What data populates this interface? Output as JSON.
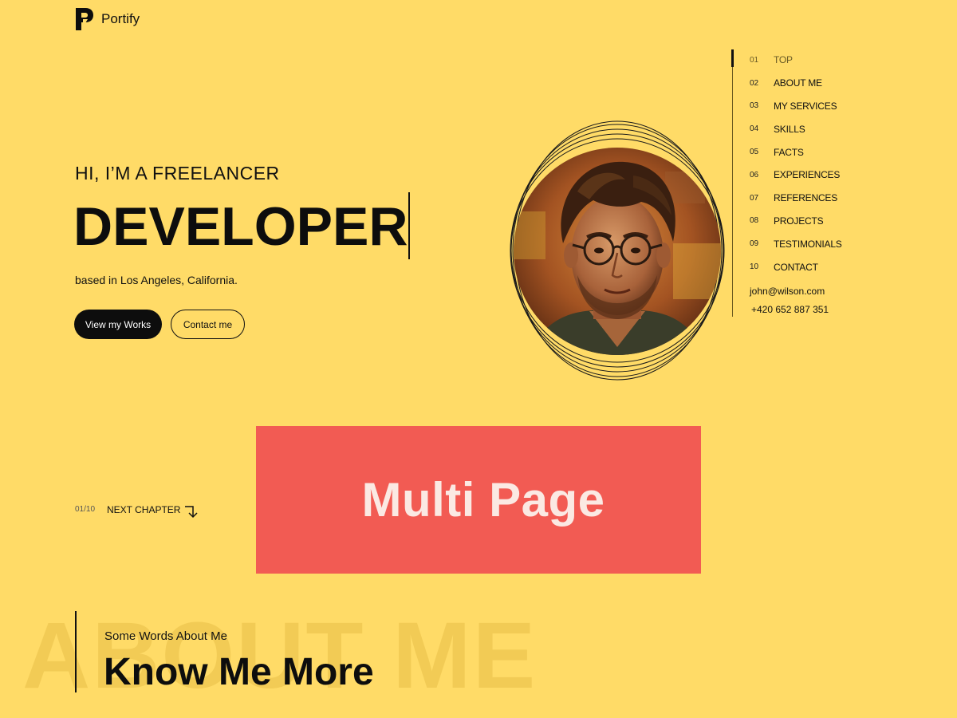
{
  "header": {
    "brand": "Portify",
    "logo_icon": "portify-p-logo"
  },
  "hero": {
    "intro": "HI, I’M A FREELANCER",
    "role": "DEVELOPER",
    "location": "based in Los Angeles, California.",
    "primary_button": "View my Works",
    "secondary_button": "Contact me"
  },
  "sidenav": {
    "items": [
      {
        "num": "01",
        "label": "TOP"
      },
      {
        "num": "02",
        "label": "ABOUT ME"
      },
      {
        "num": "03",
        "label": "MY SERVICES"
      },
      {
        "num": "04",
        "label": "SKILLS"
      },
      {
        "num": "05",
        "label": "FACTS"
      },
      {
        "num": "06",
        "label": "EXPERIENCES"
      },
      {
        "num": "07",
        "label": "REFERENCES"
      },
      {
        "num": "08",
        "label": "PROJECTS"
      },
      {
        "num": "09",
        "label": "TESTIMONIALS"
      },
      {
        "num": "10",
        "label": "CONTACT"
      }
    ],
    "active_index": 0,
    "email": "john@wilson.com",
    "phone": "+420 652 887 351"
  },
  "chapter": {
    "counter": "01/10",
    "label": "NEXT CHAPTER",
    "arrow_icon": "arrow-down-right-icon"
  },
  "banner": {
    "text": "Multi Page"
  },
  "about": {
    "background_word": "ABOUT ME",
    "subtitle": "Some Words About Me",
    "title": "Know Me More"
  },
  "colors": {
    "background": "#FFDB67",
    "banner": "#F25B53",
    "banner_text": "#FBE9E3",
    "dark": "#0d0d0d"
  }
}
